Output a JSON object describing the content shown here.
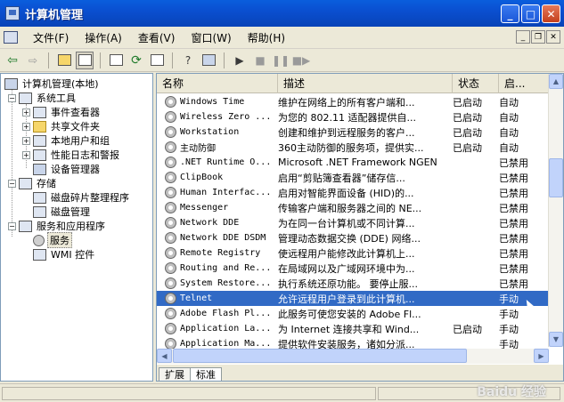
{
  "window": {
    "title": "计算机管理"
  },
  "menu": [
    "文件(F)",
    "操作(A)",
    "查看(V)",
    "窗口(W)",
    "帮助(H)"
  ],
  "tree": {
    "root": "计算机管理(本地)",
    "system_tools": "系统工具",
    "event_viewer": "事件查看器",
    "shared_folders": "共享文件夹",
    "local_users": "本地用户和组",
    "perf_logs": "性能日志和警报",
    "device_manager": "设备管理器",
    "storage": "存储",
    "defrag": "磁盘碎片整理程序",
    "disk_mgmt": "磁盘管理",
    "services_apps": "服务和应用程序",
    "services": "服务",
    "wmi": "WMI 控件"
  },
  "list": {
    "columns": [
      "名称",
      "描述",
      "状态",
      "启..."
    ],
    "rows": [
      [
        "Windows Time",
        "维护在网络上的所有客户端和...",
        "已启动",
        "自动"
      ],
      [
        "Wireless Zero ...",
        "为您的 802.11 适配器提供自...",
        "已启动",
        "自动"
      ],
      [
        "Workstation",
        "创建和维护到远程服务的客户...",
        "已启动",
        "自动"
      ],
      [
        "主动防御",
        "360主动防御的服务项，提供实...",
        "已启动",
        "自动"
      ],
      [
        ".NET Runtime O...",
        "Microsoft .NET Framework NGEN",
        "",
        "已禁用"
      ],
      [
        "ClipBook",
        "启用“剪贴簿查看器”储存信...",
        "",
        "已禁用"
      ],
      [
        "Human Interfac...",
        "启用对智能界面设备 (HID)的...",
        "",
        "已禁用"
      ],
      [
        "Messenger",
        "传输客户端和服务器之间的 NE...",
        "",
        "已禁用"
      ],
      [
        "Network DDE",
        "为在同一台计算机或不同计算...",
        "",
        "已禁用"
      ],
      [
        "Network DDE DSDM",
        "管理动态数据交换 (DDE) 网络...",
        "",
        "已禁用"
      ],
      [
        "Remote Registry",
        "使远程用户能修改此计算机上...",
        "",
        "已禁用"
      ],
      [
        "Routing and Re...",
        "在局域网以及广域网环境中为...",
        "",
        "已禁用"
      ],
      [
        "System Restore...",
        "执行系统还原功能。 要停止服...",
        "",
        "已禁用"
      ],
      [
        "Telnet",
        "允许远程用户登录到此计算机...",
        "",
        "手动"
      ],
      [
        "Adobe Flash Pl...",
        "此服务可使您安装的 Adobe Fl...",
        "",
        "手动"
      ],
      [
        "Application La...",
        "为 Internet 连接共享和 Wind...",
        "已启动",
        "手动"
      ],
      [
        "Application Ma...",
        "提供软件安装服务，诸如分派...",
        "",
        "手动"
      ]
    ],
    "selected_row": 13
  },
  "tabs": [
    "扩展",
    "标准"
  ],
  "watermark": "Baidu 经验"
}
